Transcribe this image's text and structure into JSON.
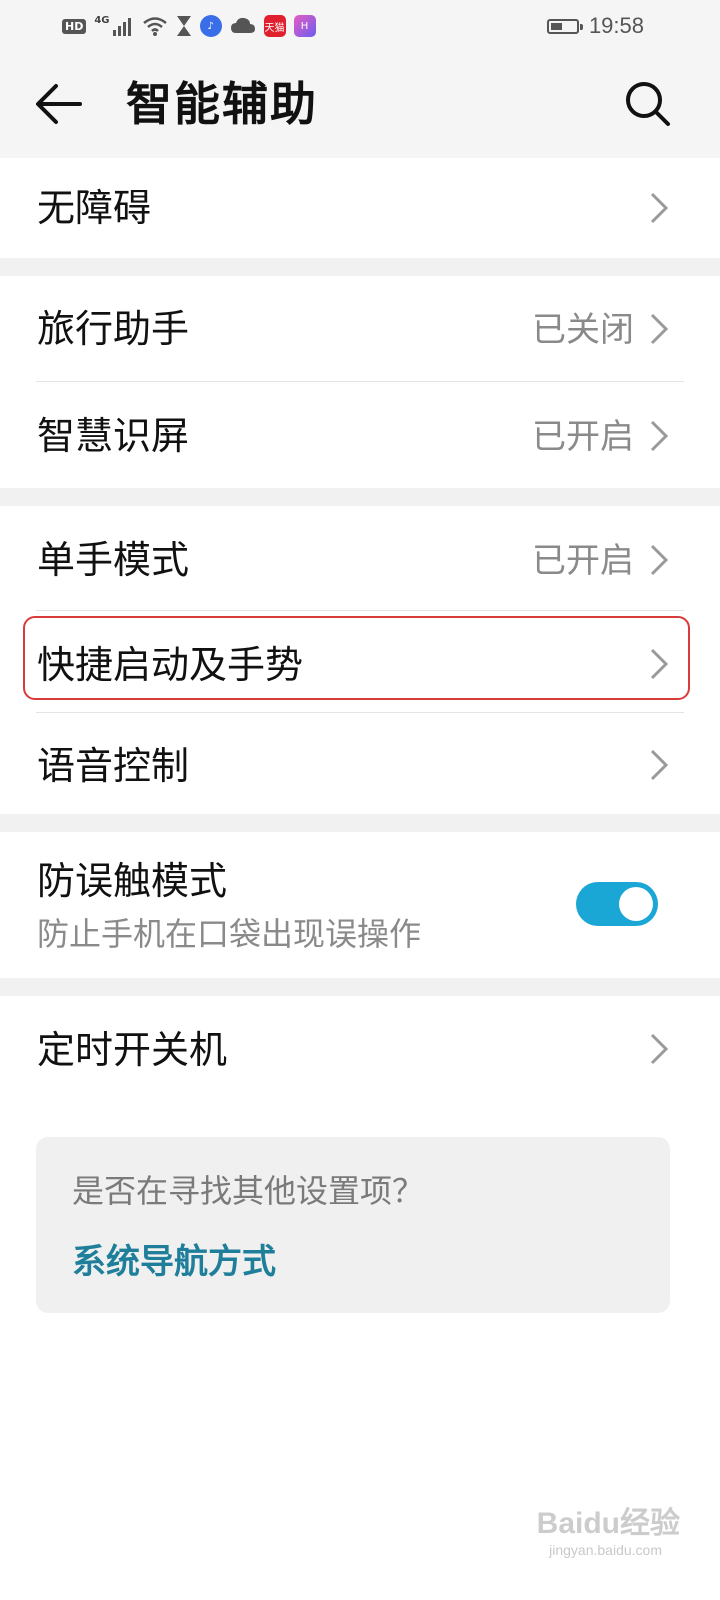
{
  "status_bar": {
    "hd": "HD",
    "network": "4G",
    "apps": [
      {
        "icon": "music-icon",
        "color": "#3a6ee8"
      },
      {
        "icon": "cloud-icon",
        "color": "#555555"
      },
      {
        "icon": "tmall-icon",
        "color": "#e0202e",
        "label": "天猫"
      },
      {
        "icon": "honor-icon",
        "color": "#b34de6"
      }
    ],
    "battery_level": 0.45,
    "time": "19:58"
  },
  "header": {
    "title": "智能辅助"
  },
  "sections": {
    "s1": {
      "item1": {
        "label": "无障碍"
      }
    },
    "s2": {
      "item1": {
        "label": "旅行助手",
        "value": "已关闭"
      },
      "item2": {
        "label": "智慧识屏",
        "value": "已开启"
      }
    },
    "s3": {
      "item1": {
        "label": "单手模式",
        "value": "已开启"
      },
      "item2": {
        "label": "快捷启动及手势"
      },
      "item3": {
        "label": "语音控制"
      }
    },
    "s4": {
      "item1": {
        "label": "防误触模式",
        "description": "防止手机在口袋出现误操作",
        "enabled": true
      }
    },
    "s5": {
      "item1": {
        "label": "定时开关机"
      }
    }
  },
  "suggestion": {
    "question": "是否在寻找其他设置项？",
    "link": "系统导航方式"
  },
  "colors": {
    "accent": "#1ba7d6",
    "link": "#1f7f9b",
    "highlight": "#d93a3a"
  },
  "watermark": {
    "text": "Baidu经验",
    "sub": "jingyan.baidu.com"
  }
}
